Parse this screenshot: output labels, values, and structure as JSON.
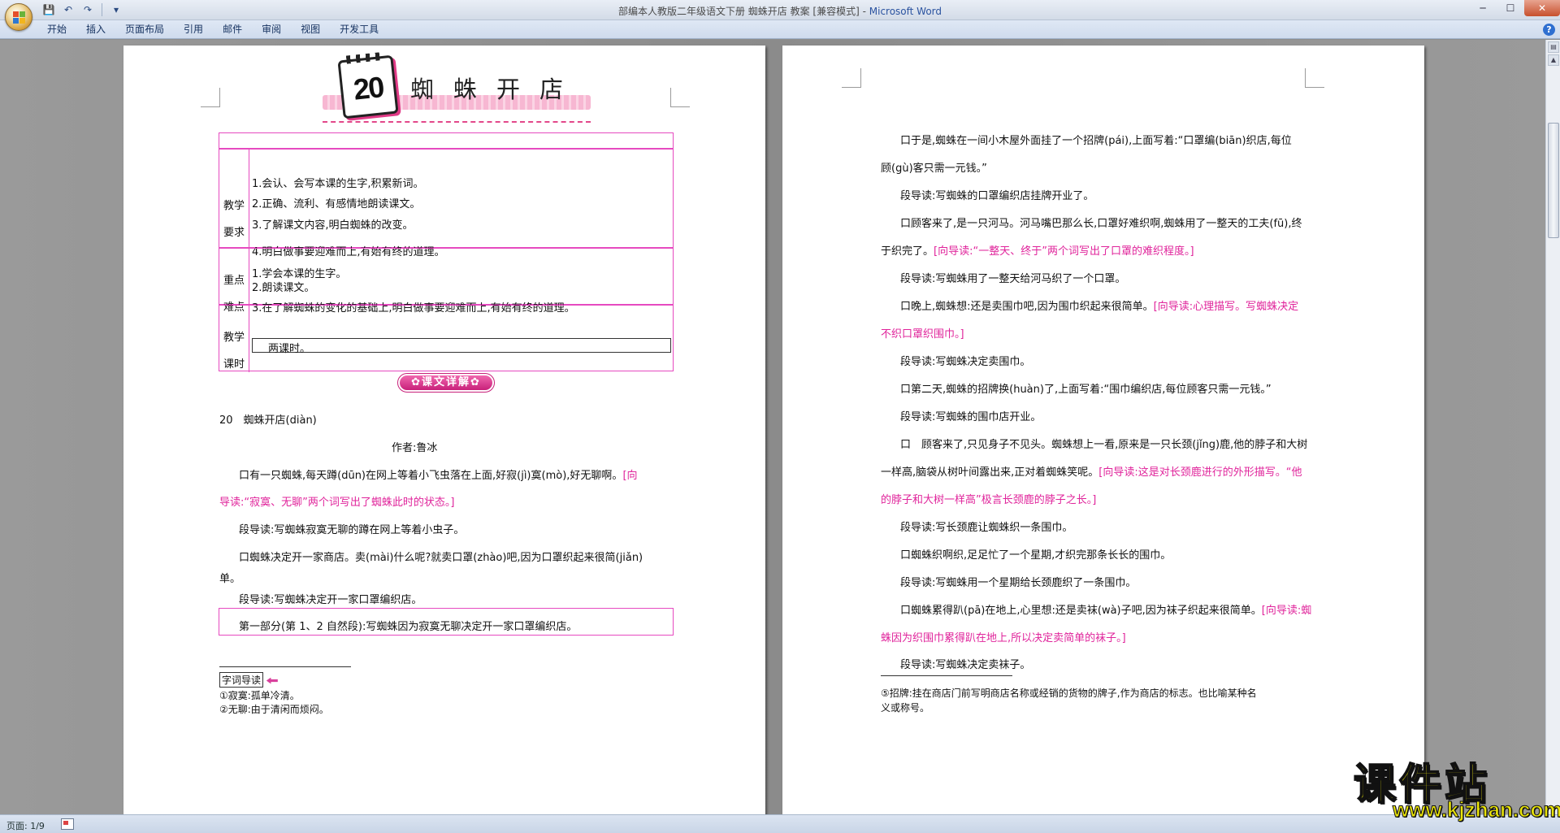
{
  "window": {
    "title_doc": "部编本人教版二年级语文下册 蜘蛛开店 教案 [兼容模式] - ",
    "title_app": "Microsoft Word"
  },
  "qat": {
    "save_icon": "💾",
    "undo_icon": "↶",
    "redo_icon": "↷",
    "customize_icon": "▾"
  },
  "win_controls": {
    "minimize": "─",
    "maximize": "☐",
    "close": "✕"
  },
  "ribbon": {
    "tabs": [
      "开始",
      "插入",
      "页面布局",
      "引用",
      "邮件",
      "审阅",
      "视图",
      "开发工具"
    ],
    "help_icon": "?"
  },
  "left_page": {
    "lesson_number": "20",
    "lesson_title": "蜘蛛开店",
    "table": {
      "goals_label_1": "教学",
      "goals_label_2": "要求",
      "goals": [
        "1.会认、会写本课的生字,积累新词。",
        "2.正确、流利、有感情地朗读课文。",
        "3.了解课文内容,明白蜘蛛的改变。",
        "4.明白做事要迎难而上,有始有终的道理。"
      ],
      "key_label_1": "重点",
      "key_label_2": "难点",
      "key": [
        "1.学会本课的生字。",
        "2.朗读课文。",
        "3.在了解蜘蛛的变化的基础上,明白做事要迎难而上,有始有终的道理。"
      ],
      "hours_label_1": "教学",
      "hours_label_2": "课时",
      "hours": "两课时。"
    },
    "banner": "✿课文详解✿",
    "heading_line": "20　蜘蛛开店(diàn)",
    "author": "作者:鲁冰",
    "p2_a": "口有一只蜘蛛,每天蹲(dūn)在网上等着小飞虫落在上面,好寂(jì)寞(mò)",
    "p2_b": ",好无聊",
    "p2_c": "啊。",
    "p2_guide_a": "[向",
    "p2_guide_b": "导读:“寂寞、无聊”两个词写出了蜘蛛此时的状态。]",
    "seg1": "段导读:写蜘蛛寂寞无聊的蹲在网上等着小虫子。",
    "p3_a": "口蜘蛛决定",
    "p3_b": "开一家商店。卖(mài)什么呢?就卖口罩(zhào)吧,因为口罩织起来很简(jiǎn)",
    "p3_c": "单",
    "p3_d": "。",
    "seg2": "段导读:写蜘蛛决定开一家口罩编织店。",
    "summary": "第一部分(第 1、2 自然段):写蜘蛛因为寂寞无聊决定开一家口罩编织店。",
    "fn_heading": "字词导读",
    "fn1": "①寂寞:孤单冷清。",
    "fn2": "②无聊:由于清闲而烦闷。"
  },
  "right_page": {
    "p4_a": "口于是,蜘蛛在一间小木屋外面挂了一个招牌(pái)",
    "p4_b": ",上面写着:“口罩编(biān)织店,每位",
    "p4_c": "顾(gù)客",
    "p4_d": "只需一元钱。”",
    "seg3": "段导读:写蜘蛛的口罩编织店挂牌开业了。",
    "p5_a": "口顾客来了,是一只河马。河马嘴巴那么长,口罩好难织啊,蜘蛛用了一整天的工夫(fū),终",
    "p5_b": "于",
    "p5_c": "织完了。",
    "p5_guide": "[向导读:“一整天、终于”两个词写出了口罩的难织程度。]",
    "seg4": "段导读:写蜘蛛用了一整天给河马织了一个口罩。",
    "p6": "口晚上,蜘蛛想:还是卖围巾吧,因为围巾织起来很简单。",
    "p6_guide_a": "[向导读:心理描写。写蜘蛛决定",
    "p6_guide_b": "不织口罩织围巾。]",
    "seg5": "段导读:写蜘蛛决定卖围巾。",
    "p7": "口第二天,蜘蛛的招牌换(huàn)了,上面写着:“围巾编织店,每位顾客只需一元钱。”",
    "seg6": "段导读:写蜘蛛的围巾店开业。",
    "p8_a": "口　顾客来了,只见身子不见头。蜘蛛想上一看,原来是一只长颈(jǐng)鹿,他的脖子和大树",
    "p8_b": "一样高,脑袋从树叶间露出来,正对着蜘蛛笑呢。",
    "p8_guide_a": "[向导读:这是对长颈鹿进行的外形描写。“他",
    "p8_guide_b": "的脖子和大树一样高”极言长颈鹿的脖子之长。]",
    "seg7": "段导读:写长颈鹿让蜘蛛织一条围巾。",
    "p9": "口蜘蛛织啊织,足足忙了一个星期,才织完那条长长的围巾。",
    "seg8": "段导读:写蜘蛛用一个星期给长颈鹿织了一条围巾。",
    "p10": "口蜘蛛累得趴(pā)在地上,心里想:还是卖袜(wà)子吧,因为袜子织起来很简单。",
    "p10_guide_a": "[向导读:蜘",
    "p10_guide_b": "蛛因为织围巾累得趴在地上,所以决定卖简单的袜子。]",
    "seg9": "段导读:写蜘蛛决定卖袜子。",
    "fn3": "⑤招牌:挂在商店门前写明商店名称或经销的货物的牌子,作为商店的标志。也比喻某种名",
    "fn4": "义或称号。"
  },
  "status": {
    "page": "页面: 1/9"
  },
  "watermark": {
    "main": "课件站",
    "url": "www.kjzhan.com"
  },
  "colors": {
    "guide_magenta": "#e0249b",
    "table_border": "#e64ac0",
    "titlebar": "#d3dbe7"
  }
}
